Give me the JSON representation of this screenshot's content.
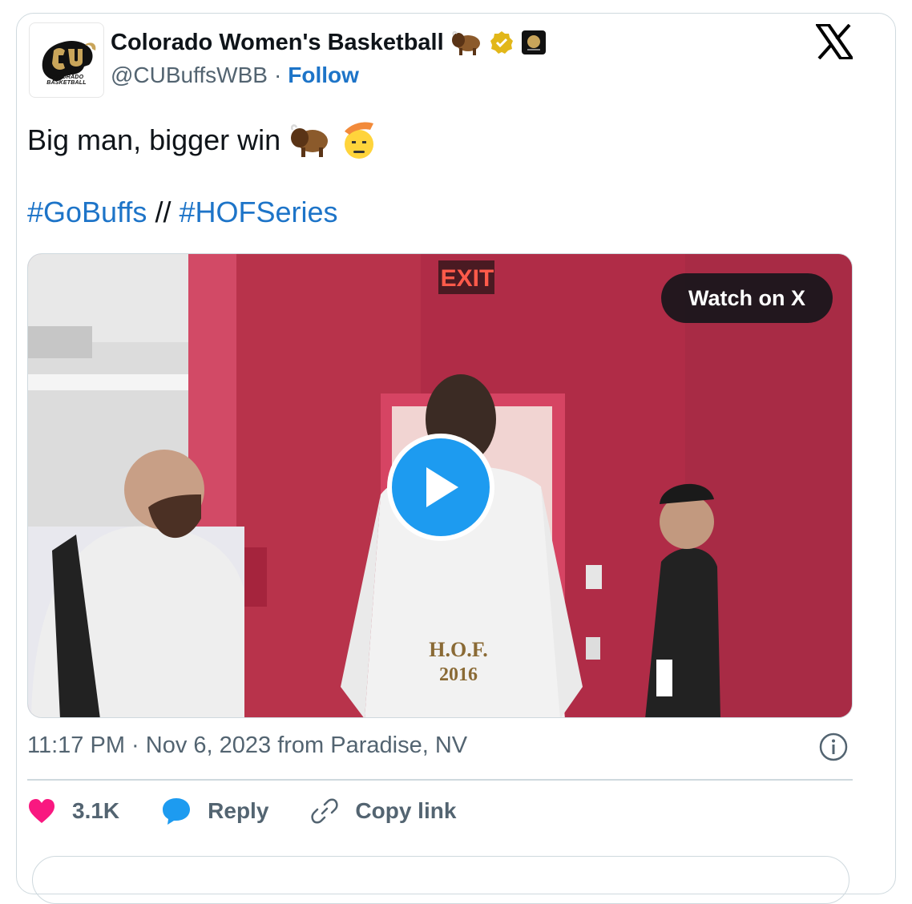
{
  "author": {
    "display_name": "Colorado Women's Basketball",
    "handle": "@CUBuffsWBB",
    "separator": "·",
    "follow_label": "Follow",
    "avatar_caption": "COLORADO BASKETBALL",
    "badges": [
      "buffalo-emoji-icon",
      "verified-badge-icon",
      "cu-affiliate-badge-icon"
    ]
  },
  "brand": {
    "icon": "x-logo-icon"
  },
  "tweet": {
    "text": "Big man, bigger win",
    "emojis": [
      "buffalo-emoji-icon",
      "saluting-face-emoji-icon"
    ],
    "hashtag_1": "#GoBuffs",
    "hashtag_separator": "//",
    "hashtag_2": "#HOFSeries"
  },
  "media": {
    "watch_label": "Watch on X",
    "exit_sign": "EXIT",
    "hoodie_text_line1": "H.O.F.",
    "hoodie_text_line2": "2016",
    "play_icon": "play-icon"
  },
  "meta": {
    "timestamp": "11:17 PM · Nov 6, 2023 from Paradise, NV",
    "info_icon": "info-icon"
  },
  "actions": {
    "like_count": "3.1K",
    "reply_label": "Reply",
    "copy_label": "Copy link"
  },
  "colors": {
    "link": "#1d74c8",
    "play_button": "#1d9bf0",
    "heart": "#f91880",
    "muted_text": "#536471",
    "border": "#cfd9de"
  }
}
